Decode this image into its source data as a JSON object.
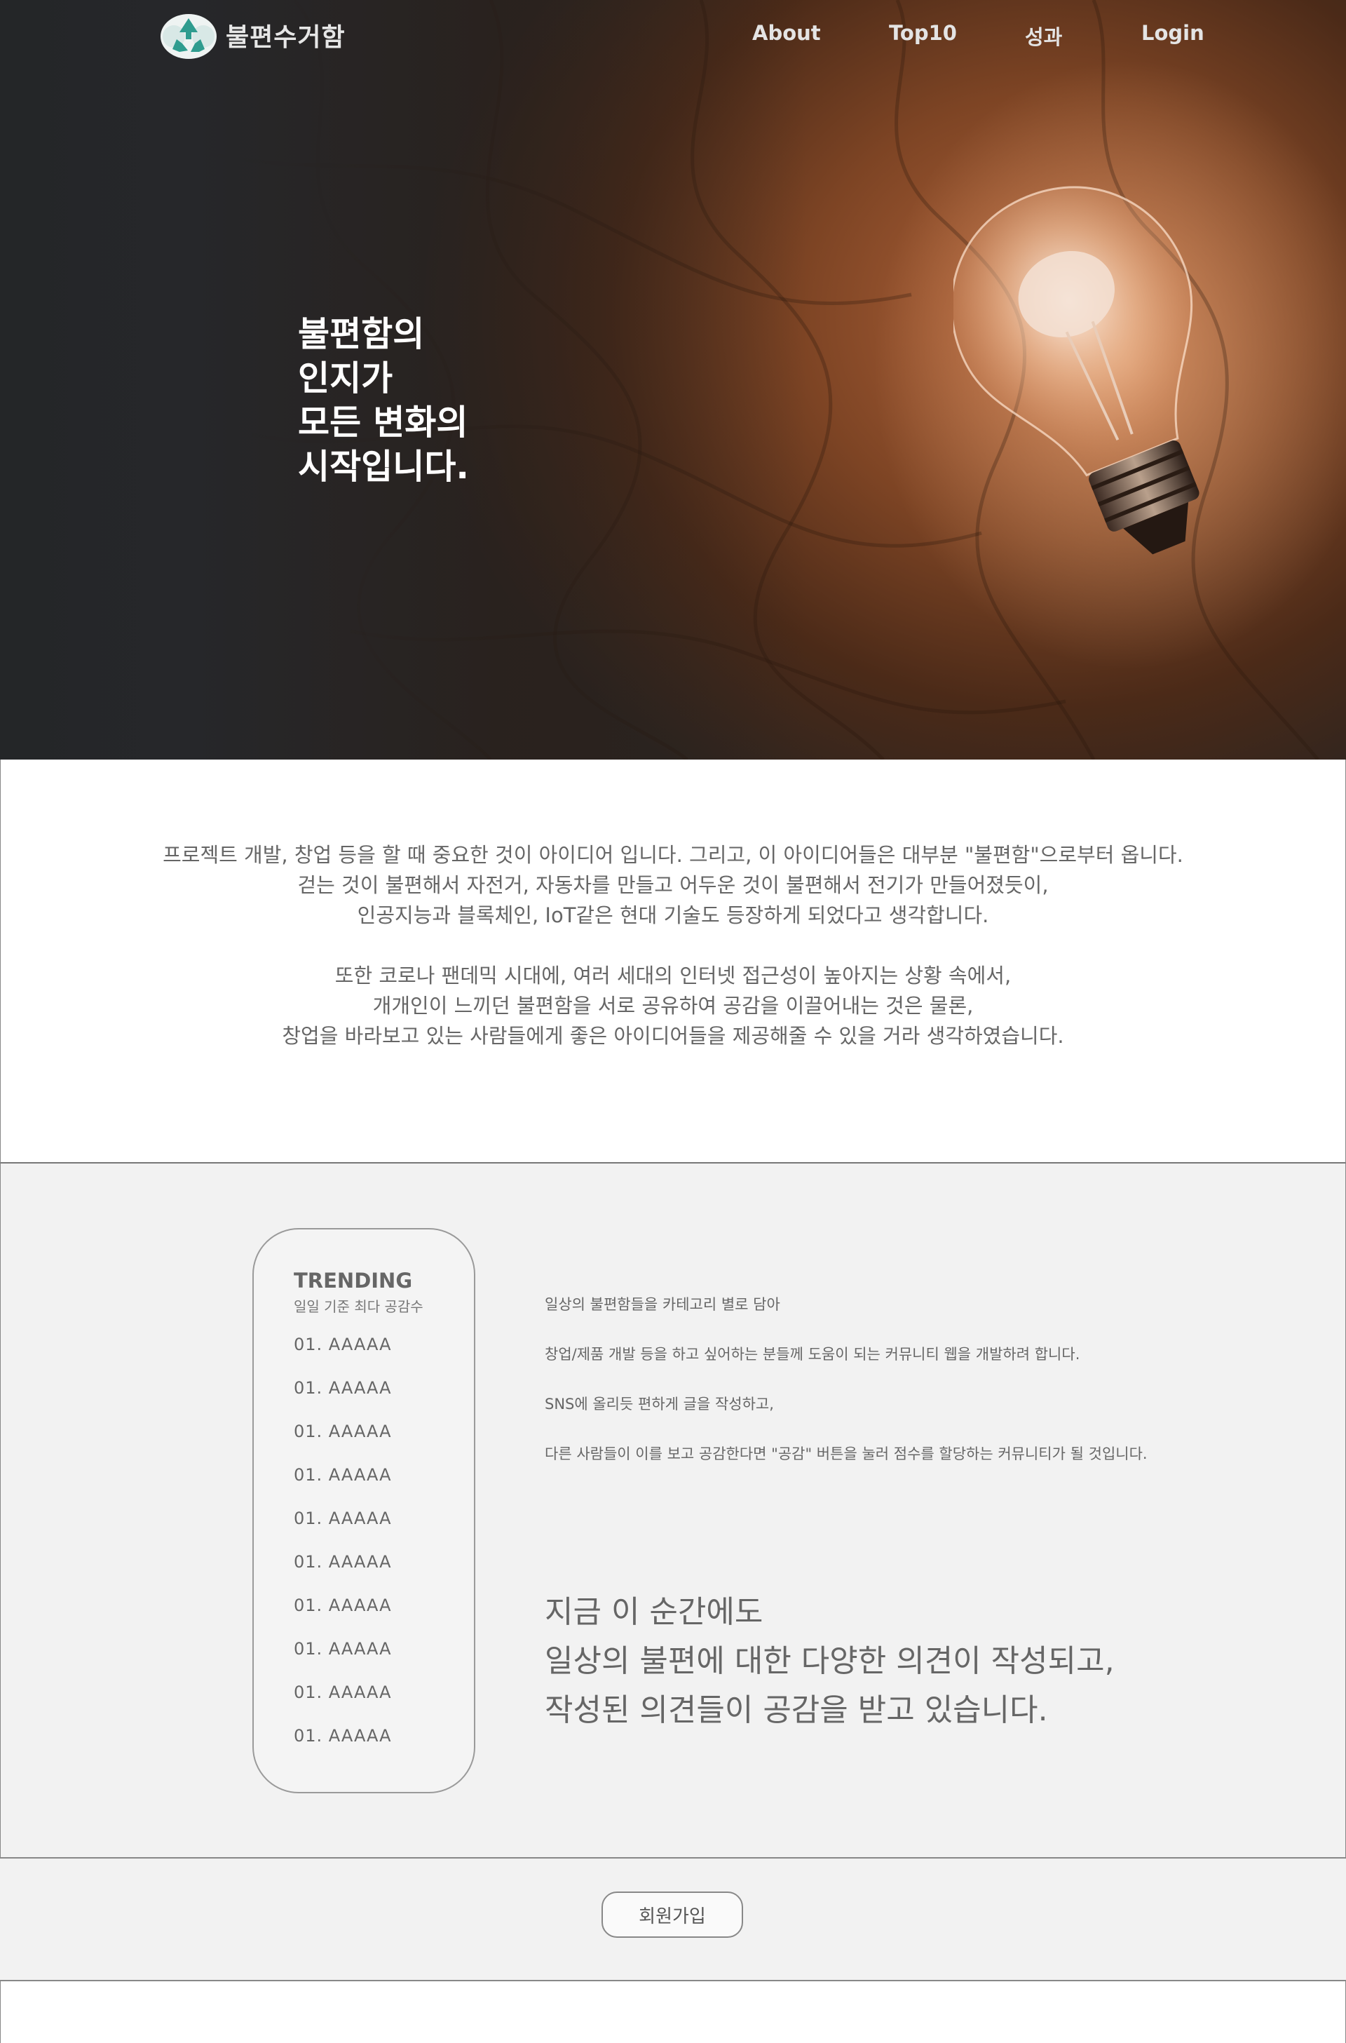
{
  "nav": {
    "brand": "불편수거함",
    "items": [
      {
        "label": "About"
      },
      {
        "label": "Top10"
      },
      {
        "label": "성과"
      },
      {
        "label": "Login"
      }
    ]
  },
  "hero": {
    "lines": [
      "불편함의",
      "인지가",
      "모든 변화의",
      "시작입니다."
    ]
  },
  "intro": {
    "paragraph1": [
      "프로젝트 개발, 창업 등을 할 때 중요한 것이 아이디어 입니다. 그리고, 이 아이디어들은 대부분 \"불편함\"으로부터 옵니다.",
      "걷는 것이 불편해서 자전거, 자동차를 만들고 어두운 것이 불편해서 전기가 만들어졌듯이,",
      "인공지능과 블록체인, IoT같은 현대 기술도 등장하게 되었다고 생각합니다."
    ],
    "paragraph2": [
      "또한 코로나 팬데믹 시대에, 여러 세대의 인터넷 접근성이 높아지는 상황 속에서,",
      "개개인이 느끼던 불편함을 서로 공유하여 공감을 이끌어내는 것은 물론,",
      "창업을 바라보고 있는 사람들에게 좋은 아이디어들을 제공해줄 수 있을 거라 생각하였습니다."
    ]
  },
  "trending": {
    "title": "TRENDING",
    "subtitle": "일일 기준 최다 공감수",
    "items": [
      "01. AAAAA",
      "01. AAAAA",
      "01. AAAAA",
      "01. AAAAA",
      "01. AAAAA",
      "01. AAAAA",
      "01. AAAAA",
      "01. AAAAA",
      "01. AAAAA",
      "01. AAAAA"
    ]
  },
  "description": [
    "일상의 불편함들을 카테고리 별로 담아",
    "창업/제품 개발 등을 하고 싶어하는 분들께 도움이 되는 커뮤니티 웹을 개발하려 합니다.",
    "SNS에 올리듯 편하게 글을 작성하고,",
    "다른 사람들이 이를 보고 공감한다면 \"공감\" 버튼을 눌러 점수를 할당하는 커뮤니티가 될 것입니다."
  ],
  "headline": [
    "지금 이 순간에도",
    "일상의 불편에 대한 다양한 의견이 작성되고,",
    "작성된 의견들이 공감을 받고 있습니다."
  ],
  "signup": {
    "label": "회원가입"
  },
  "colors": {
    "hero_dark": "#262728",
    "accent_orange": "#b2643a",
    "page_bg": "#f2f2f2"
  },
  "icons": {
    "logo": "recycle-icon"
  }
}
